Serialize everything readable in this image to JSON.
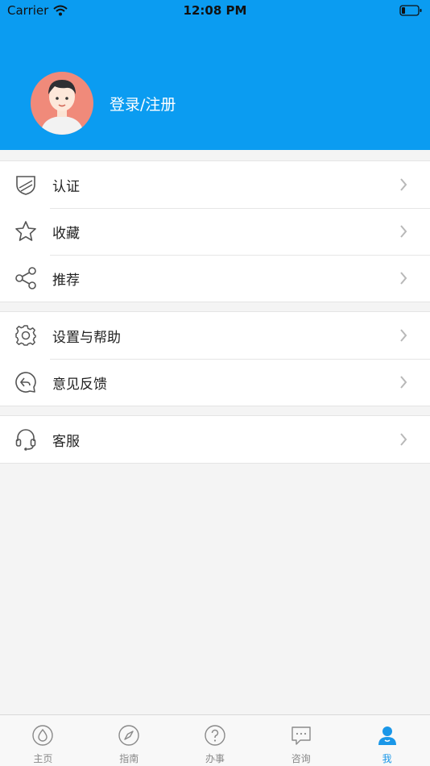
{
  "status_bar": {
    "carrier": "Carrier",
    "time": "12:08 PM"
  },
  "profile": {
    "login_label": "登录/注册"
  },
  "menu_groups": [
    {
      "items": [
        {
          "label": "认证",
          "icon": "shield-icon"
        },
        {
          "label": "收藏",
          "icon": "star-icon"
        },
        {
          "label": "推荐",
          "icon": "share-icon"
        }
      ]
    },
    {
      "items": [
        {
          "label": "设置与帮助",
          "icon": "gear-icon"
        },
        {
          "label": "意见反馈",
          "icon": "feedback-icon"
        }
      ]
    },
    {
      "items": [
        {
          "label": "客服",
          "icon": "headset-icon"
        }
      ]
    }
  ],
  "tabbar": {
    "active": "我",
    "tabs": [
      {
        "label": "主页",
        "icon": "drop-icon"
      },
      {
        "label": "指南",
        "icon": "compass-icon"
      },
      {
        "label": "办事",
        "icon": "question-icon"
      },
      {
        "label": "咨询",
        "icon": "chat-icon"
      },
      {
        "label": "我",
        "icon": "person-icon"
      }
    ]
  },
  "colors": {
    "header": "#0b9cf1",
    "active_tab": "#1a97e8",
    "avatar_bg": "#f08a7a"
  }
}
